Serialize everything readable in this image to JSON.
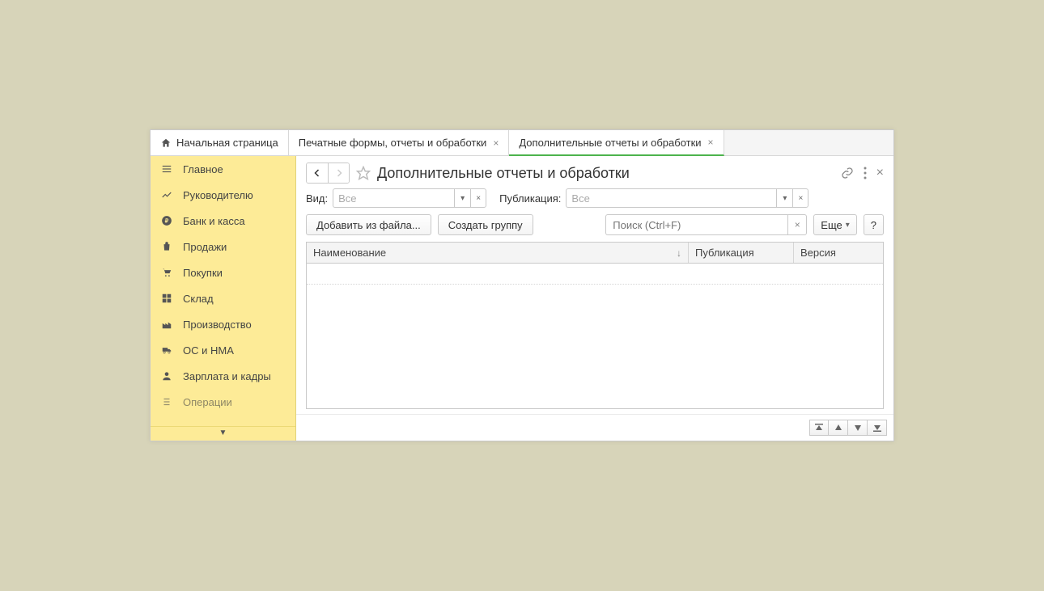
{
  "tabs": {
    "home_label": "Начальная страница",
    "tab1_label": "Печатные формы, отчеты и обработки",
    "tab2_label": "Дополнительные отчеты и обработки"
  },
  "sidebar": {
    "items": [
      {
        "label": "Главное"
      },
      {
        "label": "Руководителю"
      },
      {
        "label": "Банк и касса"
      },
      {
        "label": "Продажи"
      },
      {
        "label": "Покупки"
      },
      {
        "label": "Склад"
      },
      {
        "label": "Производство"
      },
      {
        "label": "ОС и НМА"
      },
      {
        "label": "Зарплата и кадры"
      },
      {
        "label": "Операции"
      }
    ]
  },
  "page": {
    "title": "Дополнительные отчеты и обработки"
  },
  "filters": {
    "vid_label": "Вид:",
    "vid_value": "Все",
    "pub_label": "Публикация:",
    "pub_value": "Все"
  },
  "toolbar": {
    "add_from_file": "Добавить из файла...",
    "create_group": "Создать группу",
    "search_placeholder": "Поиск (Ctrl+F)",
    "more": "Еще",
    "help": "?"
  },
  "table": {
    "col_name": "Наименование",
    "col_pub": "Публикация",
    "col_ver": "Версия"
  }
}
